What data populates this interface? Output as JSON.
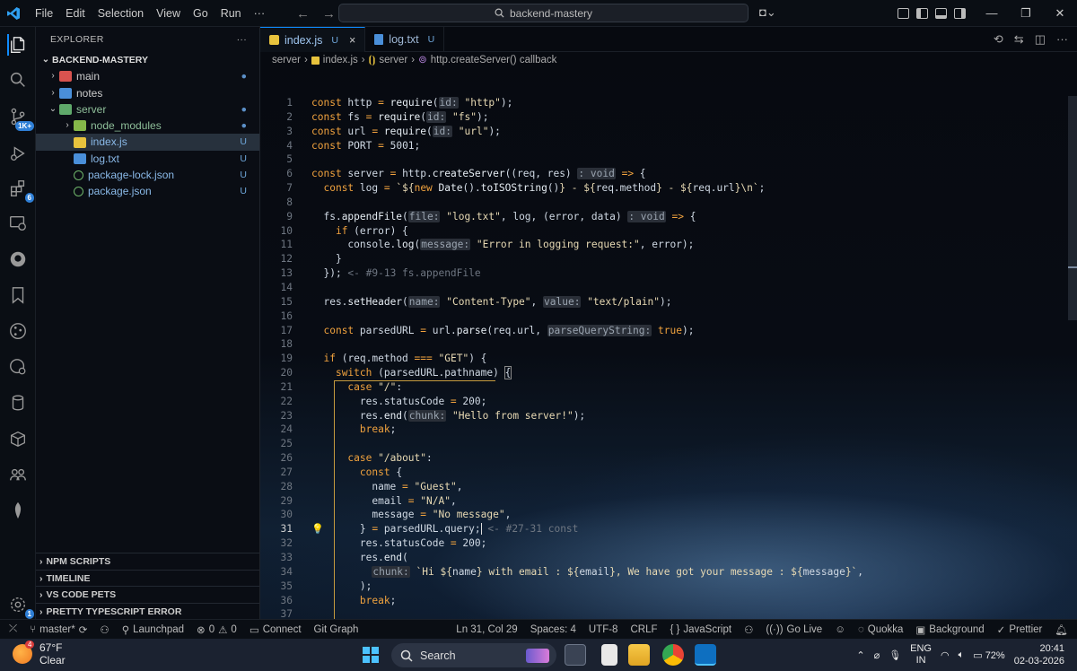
{
  "menu": [
    "File",
    "Edit",
    "Selection",
    "View",
    "Go",
    "Run",
    "···"
  ],
  "search": "backend-mastery",
  "sidebar": {
    "title": "EXPLORER",
    "more": "···",
    "project": "BACKEND-MASTERY",
    "items": [
      {
        "label": "main",
        "stat": "●"
      },
      {
        "label": "notes",
        "stat": ""
      },
      {
        "label": "server",
        "stat": "●"
      },
      {
        "label": "node_modules",
        "stat": "●"
      },
      {
        "label": "index.js",
        "stat": "U"
      },
      {
        "label": "log.txt",
        "stat": "U"
      },
      {
        "label": "package-lock.json",
        "stat": "U"
      },
      {
        "label": "package.json",
        "stat": "U"
      }
    ],
    "sections": [
      "NPM SCRIPTS",
      "TIMELINE",
      "VS CODE PETS",
      "PRETTY TYPESCRIPT ERROR"
    ]
  },
  "activity_badges": {
    "source_control": "1K+",
    "extensions": "6",
    "settings": "1"
  },
  "tabs": [
    {
      "label": "index.js",
      "status": "U",
      "close": "×"
    },
    {
      "label": "log.txt",
      "status": "U"
    }
  ],
  "breadcrumb": [
    "server",
    "index.js",
    "server",
    "http.createServer() callback"
  ],
  "code": {
    "current_line": "31"
  },
  "status": {
    "branch": "master*",
    "launchpad": "Launchpad",
    "errors": "0",
    "warnings": "0",
    "connect": "Connect",
    "git_graph": "Git Graph",
    "position": "Ln 31, Col 29",
    "spaces": "Spaces: 4",
    "encoding": "UTF-8",
    "eol": "CRLF",
    "language": "JavaScript",
    "golive": "Go Live",
    "quokka": "Quokka",
    "background": "Background",
    "prettier": "Prettier"
  },
  "taskbar": {
    "weather_temp": "67°F",
    "weather_desc": "Clear",
    "weather_badge": "4",
    "search": "Search",
    "lang": "ENG",
    "region": "IN",
    "battery": "72%",
    "time": "20:41",
    "date": "02-03-2026"
  }
}
